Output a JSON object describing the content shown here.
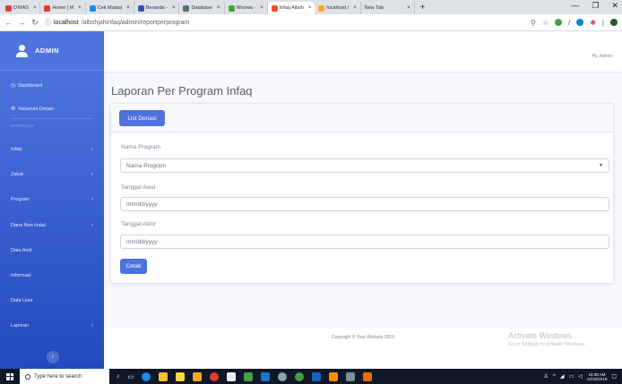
{
  "browser": {
    "tabs": [
      {
        "label": "D'MAS",
        "color": "#e53935",
        "active": false
      },
      {
        "label": "Home | M",
        "color": "#e53935",
        "active": false
      },
      {
        "label": "Cek Mutasi",
        "color": "#1e88e5",
        "active": false
      },
      {
        "label": "Beranda -",
        "color": "#3f51b5",
        "active": false
      },
      {
        "label": "Database",
        "color": "#546e7a",
        "active": false
      },
      {
        "label": "Woowa -",
        "color": "#43a047",
        "active": false
      },
      {
        "label": "Infaq Albsh",
        "color": "#f4511e",
        "active": true
      },
      {
        "label": "localhost /",
        "color": "#f9a825",
        "active": false
      },
      {
        "label": "New Tab",
        "color": "",
        "active": false
      }
    ],
    "new_tab": "+",
    "url_host": "localhost",
    "url_path": "/albshjahinfaq/admin/reportperprogram",
    "window_controls": [
      "—",
      "❐",
      "✕"
    ]
  },
  "sidebar": {
    "brand": "ADMIN",
    "items": [
      {
        "label": "Dashboard",
        "icon": "◷",
        "arrow": ""
      },
      {
        "label": "Halaman Depan",
        "icon": "⚙",
        "arrow": ""
      },
      {
        "label": "Infaq",
        "icon": "",
        "arrow": "›"
      },
      {
        "label": "Zakat",
        "icon": "",
        "arrow": "›"
      },
      {
        "label": "Program",
        "icon": "",
        "arrow": "›"
      },
      {
        "label": "Dana Non Halal",
        "icon": "",
        "arrow": "›"
      },
      {
        "label": "Data Amil",
        "icon": "",
        "arrow": ""
      },
      {
        "label": "Informasi",
        "icon": "",
        "arrow": ""
      },
      {
        "label": "Data User",
        "icon": "",
        "arrow": ""
      },
      {
        "label": "Laporan",
        "icon": "",
        "arrow": "›"
      }
    ],
    "heading": "INTERFACE",
    "toggle": "‹"
  },
  "topbar": {
    "greeting": "Hy, Admin"
  },
  "page": {
    "title": "Laporan Per Program Infaq",
    "list_button": "List Donasi",
    "program_label": "Nama Program",
    "program_select": "Nama Program",
    "start_label": "Tanggal Awal",
    "start_placeholder": "mm/dd/yyyy",
    "end_label": "Tanggal Akhir",
    "end_placeholder": "mm/dd/yyyy",
    "print_button": "Cetak"
  },
  "footer": {
    "copyright": "Copyright © Your Website 2019"
  },
  "watermark": {
    "line1": "Activate Windows",
    "line2": "Go to Settings to activate Windows."
  },
  "taskbar": {
    "search": "Type here to search",
    "time": "10:39 AM",
    "date": "12/16/2019",
    "app_colors": [
      "#0078d7",
      "#1e88e5",
      "#f9a825",
      "#fbc02d",
      "#0288d1",
      "#e53935",
      "#29b6f6",
      "#43a047",
      "#5c6bc0",
      "#fdd835",
      "#ef5350",
      "#1565c0",
      "#fb8c00",
      "#90a4ae",
      "#fbc02d"
    ]
  }
}
